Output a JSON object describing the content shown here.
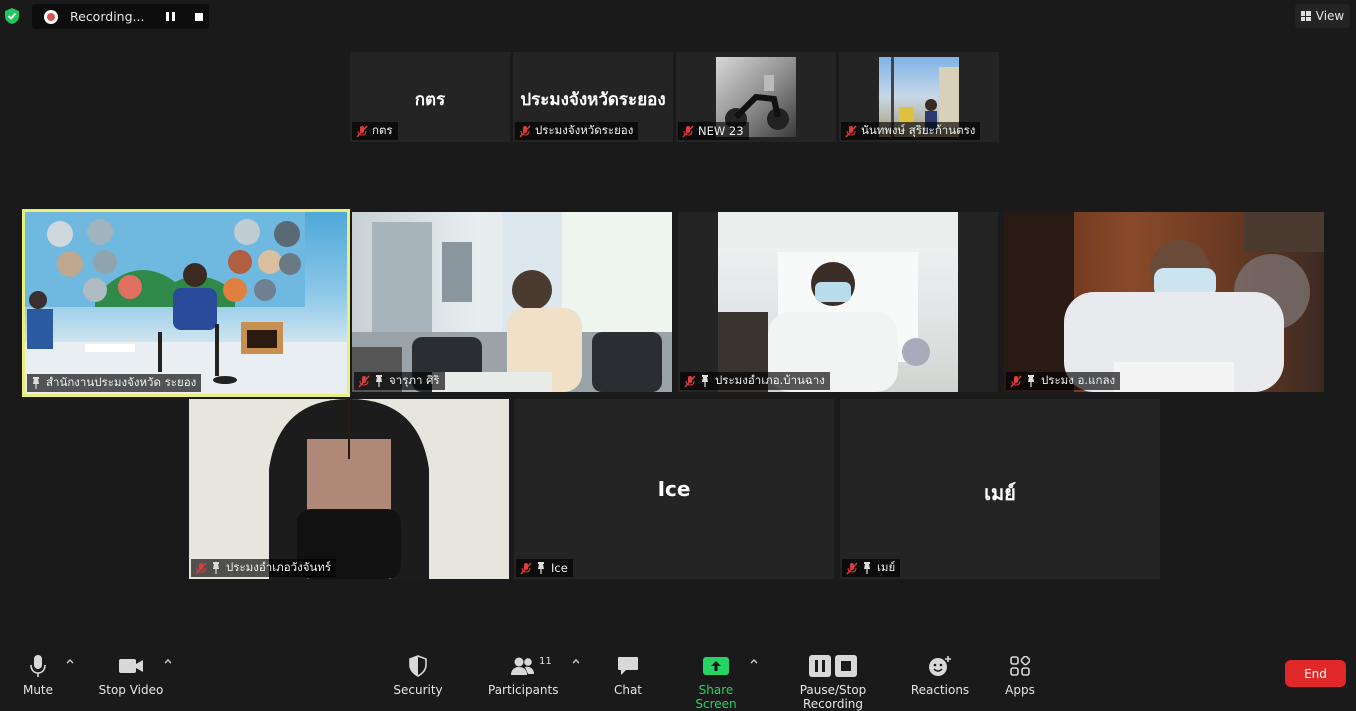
{
  "recording": {
    "status_text": "Recording..."
  },
  "view_button": {
    "label": "View"
  },
  "top_strip": [
    {
      "big_name": "กตร",
      "label": "กตร",
      "muted": true,
      "type": "name"
    },
    {
      "big_name": "ประมงจังหวัดระยอง",
      "label": "ประมงจังหวัดระยอง",
      "muted": true,
      "type": "name"
    },
    {
      "label": "NEW 23",
      "muted": true,
      "type": "photo"
    },
    {
      "label": "นันทพงษ์ สุริยะก้านตรง",
      "muted": true,
      "type": "photo"
    }
  ],
  "gallery": [
    {
      "label": "สำนักงานประมงจังหวัด ระยอง",
      "muted": false,
      "pinned": true,
      "active_speaker": true
    },
    {
      "label": "จารุภา  ศิริ",
      "muted": true,
      "pinned": true
    },
    {
      "label": "ประมงอำเภอ.บ้านฉาง",
      "muted": true,
      "pinned": true
    },
    {
      "label": "ประมง อ.แกลง",
      "muted": true,
      "pinned": true
    },
    {
      "label": "ประมงอำเภอวังจันทร์",
      "muted": true,
      "pinned": true
    },
    {
      "big_name": "Ice",
      "label": "Ice",
      "muted": true,
      "pinned": true
    },
    {
      "big_name": "เมย์",
      "label": "เมย์",
      "muted": true,
      "pinned": true
    }
  ],
  "toolbar": {
    "mute": "Mute",
    "stop_video": "Stop Video",
    "security": "Security",
    "participants": "Participants",
    "participants_count": "11",
    "chat": "Chat",
    "share_screen": "Share Screen",
    "pause_stop_recording": "Pause/Stop Recording",
    "reactions": "Reactions",
    "apps": "Apps",
    "end": "End"
  },
  "colors": {
    "accent_green": "#26d365",
    "end_red": "#e02828",
    "active_speaker_border": "#e8f07a",
    "recording_red": "#d9534f"
  }
}
